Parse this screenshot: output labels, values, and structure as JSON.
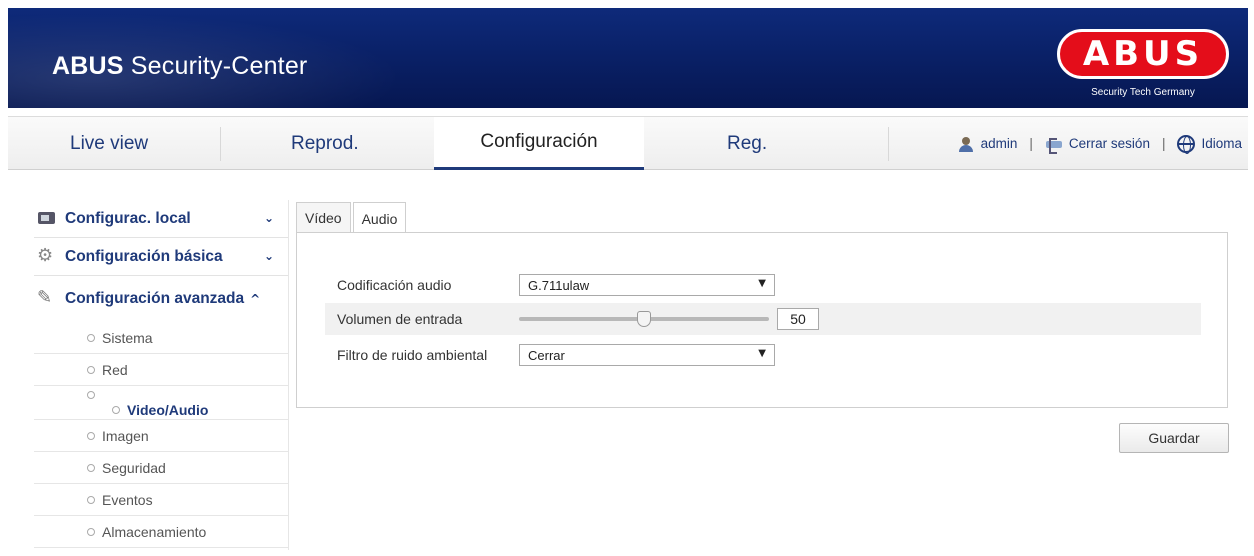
{
  "header": {
    "title_bold": "ABUS",
    "title_rest": " Security-Center",
    "logo_text": "ABUS",
    "logo_sub": "Security Tech Germany",
    "brand_color": "#e40d1a",
    "bar_color": "#0a2168"
  },
  "topnav": {
    "tabs": [
      {
        "label": "Live view"
      },
      {
        "label": "Reprod."
      },
      {
        "label": "Configuración"
      },
      {
        "label": "Reg."
      }
    ],
    "active_tab": "Configuración",
    "user_icon": "user-icon",
    "user": "admin",
    "logout_icon": "logout-icon",
    "logout": "Cerrar sesión",
    "language_icon": "globe-icon",
    "language": "Idioma",
    "separator": "|"
  },
  "sidebar": {
    "groups": [
      {
        "label": "Configurac. local",
        "icon": "monitor-icon",
        "expanded": false
      },
      {
        "label": "Configuración básica",
        "icon": "gear-icon",
        "expanded": false
      },
      {
        "label": "Configuración avanzada",
        "icon": "wrench-icon",
        "expanded": true
      }
    ],
    "items": [
      {
        "label": "Sistema"
      },
      {
        "label": "Red"
      },
      {
        "label": "Video/Audio"
      },
      {
        "label": "Imagen"
      },
      {
        "label": "Seguridad"
      },
      {
        "label": "Eventos"
      },
      {
        "label": "Almacenamiento"
      }
    ],
    "active_item": "Video/Audio"
  },
  "content": {
    "tabs": [
      {
        "label": "Vídeo"
      },
      {
        "label": "Audio"
      }
    ],
    "active_tab": "Audio",
    "fields": {
      "encoding": {
        "label": "Codificación audio",
        "value": "G.711ulaw"
      },
      "volume": {
        "label": "Volumen de entrada",
        "value": "50",
        "level_percent": 50
      },
      "noise_filter": {
        "label": "Filtro de ruido ambiental",
        "value": "Cerrar"
      }
    },
    "save_label": "Guardar"
  }
}
